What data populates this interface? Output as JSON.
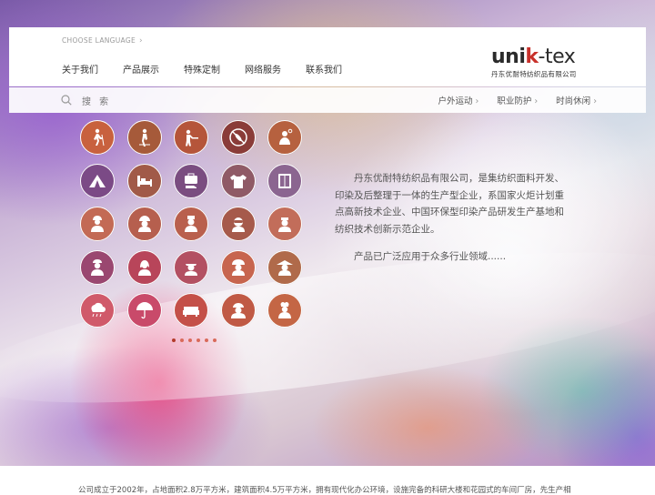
{
  "language": {
    "label": "CHOOSE LANGUAGE"
  },
  "nav": {
    "items": [
      {
        "label": "关于我们"
      },
      {
        "label": "产品展示"
      },
      {
        "label": "特殊定制"
      },
      {
        "label": "网络服务"
      },
      {
        "label": "联系我们"
      }
    ]
  },
  "logo": {
    "brand": "UNIK-TEX",
    "brand_left": "uni",
    "brand_k": "k",
    "brand_right": "-tex",
    "subtitle": "丹东优耐特纺织品有限公司"
  },
  "search": {
    "label": "搜 索"
  },
  "categories": [
    {
      "label": "户外运动"
    },
    {
      "label": "职业防护"
    },
    {
      "label": "时尚休闲"
    }
  ],
  "icons": [
    {
      "name": "hiker-icon",
      "color": "#c8613e"
    },
    {
      "name": "skier-icon",
      "color": "#a65a3a"
    },
    {
      "name": "hunter-icon",
      "color": "#b5553a"
    },
    {
      "name": "mosquito-icon",
      "color": "#8a3c38"
    },
    {
      "name": "sun-person-icon",
      "color": "#b6613f"
    },
    {
      "name": "tent-icon",
      "color": "#7b4a86"
    },
    {
      "name": "bed-icon",
      "color": "#a15a48"
    },
    {
      "name": "bag-shoe-icon",
      "color": "#7a4d80"
    },
    {
      "name": "clothes-icon",
      "color": "#8f5a66"
    },
    {
      "name": "wardrobe-icon",
      "color": "#8b6590"
    },
    {
      "name": "worker-icon",
      "color": "#c36a55"
    },
    {
      "name": "builder-icon",
      "color": "#b65f4e"
    },
    {
      "name": "nurse-icon",
      "color": "#b9604d"
    },
    {
      "name": "goggles-worker-icon",
      "color": "#a65a4b"
    },
    {
      "name": "doctor-icon",
      "color": "#c26d5a"
    },
    {
      "name": "cook-icon",
      "color": "#9a4770"
    },
    {
      "name": "woman-icon",
      "color": "#b8455a"
    },
    {
      "name": "pilot-icon",
      "color": "#b35062"
    },
    {
      "name": "firefighter-icon",
      "color": "#c7654e"
    },
    {
      "name": "farmer-icon",
      "color": "#b06a4a"
    },
    {
      "name": "rain-icon",
      "color": "#d05a6a"
    },
    {
      "name": "umbrella-icon",
      "color": "#c94a6a"
    },
    {
      "name": "sofa-icon",
      "color": "#c45048"
    },
    {
      "name": "soldier-icon",
      "color": "#c05a45"
    },
    {
      "name": "chef-icon",
      "color": "#c46645"
    }
  ],
  "carousel": {
    "count": 6,
    "active": 0
  },
  "intro": {
    "paragraph1": "丹东优耐特纺织品有限公司，是集纺织面料开发、印染及后整理于一体的生产型企业，系国家火炬计划重点高新技术企业、中国环保型印染产品研发生产基地和纺织技术创新示范企业。",
    "paragraph2": "产品已广泛应用于众多行业领域......"
  },
  "footer": {
    "text": "公司成立于2002年，占地面积2.8万平方米，建筑面积4.5万平方米，拥有现代化办公环境，设施完备的科研大楼和花园式的车间厂房，先生产相"
  }
}
